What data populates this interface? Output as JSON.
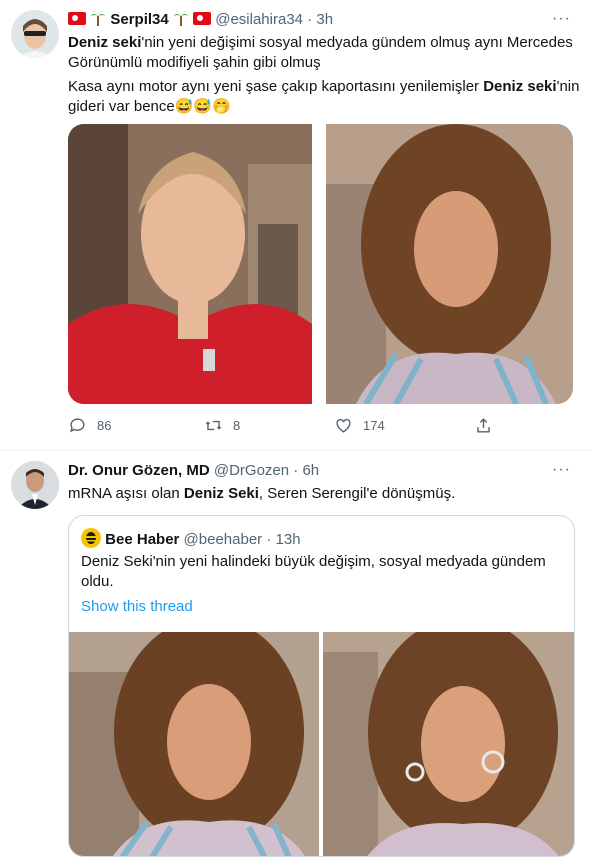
{
  "tweet1": {
    "display_name": "Serpil34",
    "handle": "@esilahira34",
    "time": "3h",
    "line1_bold": "Deniz seki",
    "line1_rest": "'nin yeni değişimi sosyal medyada gündem olmuş aynı Mercedes",
    "line2": "Görünümlü modifiyeli şahin gibi olmuş",
    "line3_start": "Kasa aynı motor aynı yeni şase çakıp kaportasını yenilemişler ",
    "line3_bold": "Deniz seki",
    "line3_end": "'nin",
    "line4": "gideri var bence😅😅🤭",
    "replies": "86",
    "retweets": "8",
    "likes": "174"
  },
  "tweet2": {
    "display_name": "Dr. Onur Gözen, MD",
    "handle": "@DrGozen",
    "time": "6h",
    "text_start": "mRNA aşısı olan ",
    "text_bold": "Deniz Seki",
    "text_end": ", Seren Serengil'e dönüşmüş."
  },
  "quoted": {
    "display_name": "Bee Haber",
    "handle": "@beehaber",
    "time": "13h",
    "line1": "Deniz Seki'nin yeni halindeki büyük değişim, sosyal medyada gündem",
    "line2": "oldu.",
    "show_thread": "Show this thread"
  },
  "separator": "·",
  "more_label": "···",
  "colors": {
    "accent": "#1d9bf0",
    "muted": "#536471",
    "border": "#cfd9de"
  }
}
